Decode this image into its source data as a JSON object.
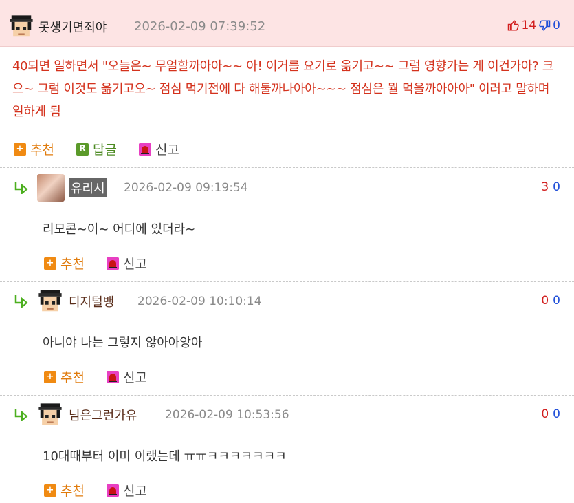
{
  "main_comment": {
    "author": "못생기면죄야",
    "timestamp": "2026-02-09 07:39:52",
    "upvotes": "14",
    "downvotes": "0",
    "body": "40되면 일하면서 \"오늘은~ 무얼할까아아~~ 아! 이거를 요기로 옮기고~~ 그럼 영향가는 게 이건가아? 크으~ 그럼 이것도 옮기고오~ 점심 먹기전에 다 해둘까나아아~~~ 점심은 뭘 먹을까아아아\" 이러고 말하며 일하게 됨",
    "actions": {
      "recommend": "추천",
      "reply": "답글",
      "report": "신고"
    }
  },
  "replies": [
    {
      "author": "유리시",
      "timestamp": "2026-02-09 09:19:54",
      "up": "3",
      "down": "0",
      "body": "리모콘~이~ 어디에 있더라~",
      "recommend": "추천",
      "report": "신고"
    },
    {
      "author": "디지털뱅",
      "timestamp": "2026-02-09 10:10:14",
      "up": "0",
      "down": "0",
      "body": "아니야 나는 그렇지 않아아앙아",
      "recommend": "추천",
      "report": "신고"
    },
    {
      "author": "님은그런가유",
      "timestamp": "2026-02-09 10:53:56",
      "up": "0",
      "down": "0",
      "body": "10대때부터 이미 이랬는데 ㅠㅠㅋㅋㅋㅋㅋㅋㅋ",
      "recommend": "추천",
      "report": "신고"
    }
  ],
  "icons": {
    "plus": "+",
    "reply_badge": "R",
    "thumbs_up": "thumbs-up-icon",
    "thumbs_down": "thumbs-down-icon"
  },
  "colors": {
    "header_bg": "#fde4e4",
    "main_text": "#d4321d",
    "upvote": "#d21e1e",
    "downvote": "#1f4ed8",
    "recommend": "#f08a12"
  }
}
